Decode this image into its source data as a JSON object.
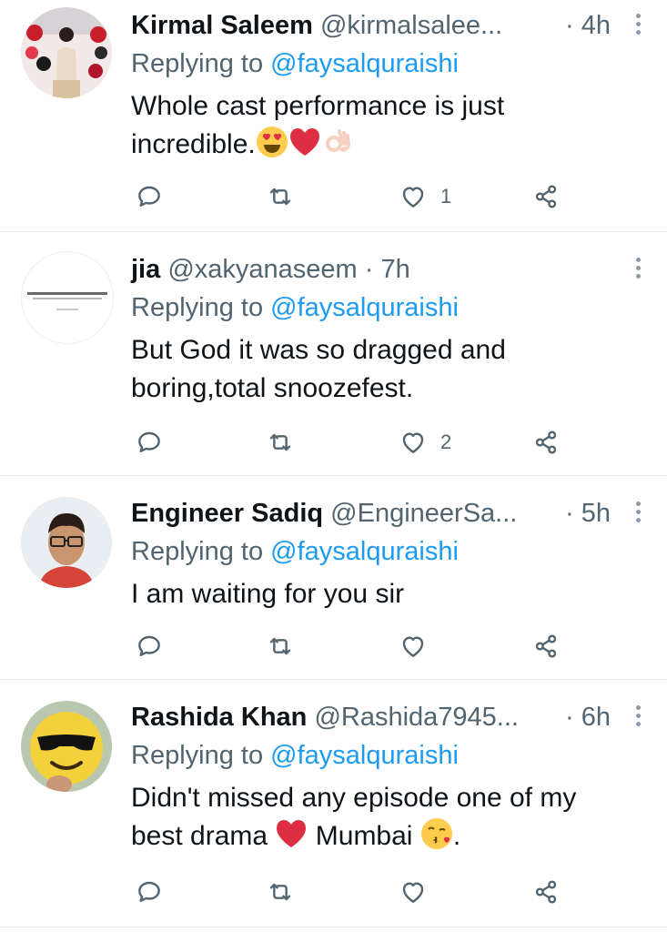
{
  "tweets": [
    {
      "name": "Kirmal Saleem",
      "handle": "@kirmalsalee...",
      "time": "· 4h",
      "reply_prefix": "Replying to",
      "reply_to": "@faysalquraishi",
      "text_line1": "Whole cast performance is just",
      "text_line2": "incredible.",
      "emojis": [
        "heart-eyes-emoji",
        "red-heart-emoji",
        "ok-hand-emoji"
      ],
      "likes": "1"
    },
    {
      "name": "jia",
      "handle": "@xakyanaseem",
      "time": "· 7h",
      "reply_prefix": "Replying to",
      "reply_to": "@faysalquraishi",
      "text_line1": "But God it was so dragged and",
      "text_line2": "boring,total snoozefest.",
      "likes": "2"
    },
    {
      "name": "Engineer Sadiq",
      "handle": "@EngineerSa...",
      "time": "· 5h",
      "reply_prefix": "Replying to",
      "reply_to": "@faysalquraishi",
      "text_line1": "I am waiting for you sir",
      "likes": ""
    },
    {
      "name": "Rashida Khan",
      "handle": "@Rashida7945...",
      "time": "· 6h",
      "reply_prefix": "Replying to",
      "reply_to": "@faysalquraishi",
      "text_line1": "Didn't missed any episode one of my",
      "text_line2a": "best drama",
      "text_line2b": "Mumbai",
      "text_line2c": ".",
      "likes": ""
    }
  ],
  "colors": {
    "accent": "#1d9bf0",
    "secondary": "#536471",
    "heart": "#e0245e"
  },
  "icons": [
    "reply-icon",
    "retweet-icon",
    "like-icon",
    "share-icon",
    "more-icon"
  ]
}
